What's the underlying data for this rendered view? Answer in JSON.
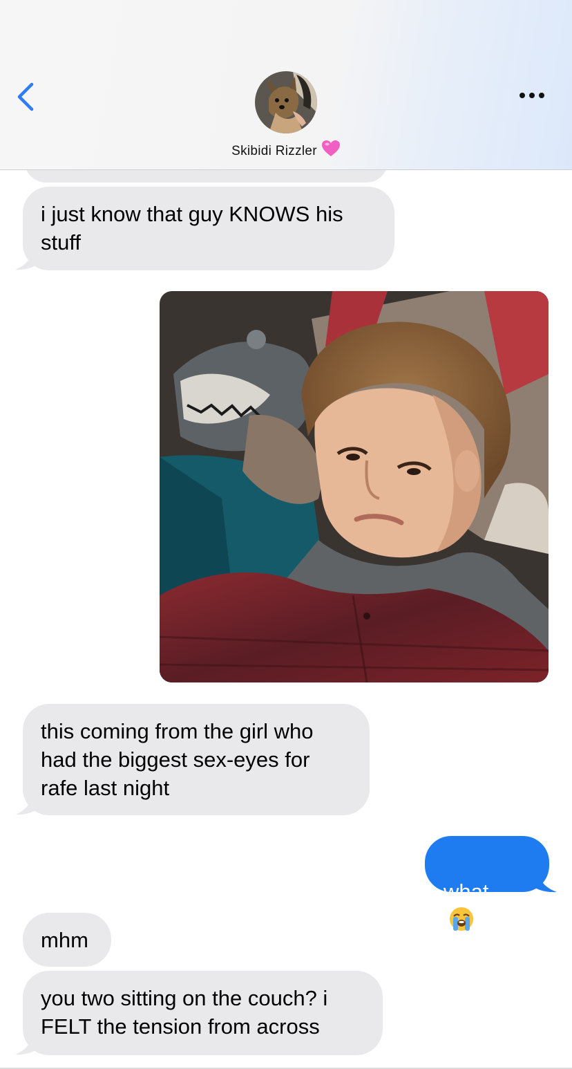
{
  "header": {
    "contact_name": "Skibidi Rizzler",
    "name_emoji": "pink-heart-icon",
    "back_icon": "chevron-left-icon",
    "more_icon": "ellipsis-icon",
    "avatar_icon": "contact-photo-dog"
  },
  "messages": [
    {
      "direction": "received",
      "text": "i just know that guy KNOWS his\nstuff"
    },
    {
      "direction": "sent",
      "type": "image",
      "icon": "photo-boy-on-couch"
    },
    {
      "direction": "received",
      "text": "this coming from the girl who\nhad the biggest sex-eyes for\nrafe last night"
    },
    {
      "direction": "sent",
      "text": "what",
      "emoji": "loudly-crying-face-icon"
    },
    {
      "direction": "received",
      "text": "mhm"
    },
    {
      "direction": "received",
      "text": "you two sitting on the couch? i\nFELT the tension from across"
    }
  ],
  "colors": {
    "sent_bubble": "#1f7cf0",
    "received_bubble": "#e9e9eb",
    "accent": "#2f7df6",
    "heart": "#f05fc4"
  }
}
